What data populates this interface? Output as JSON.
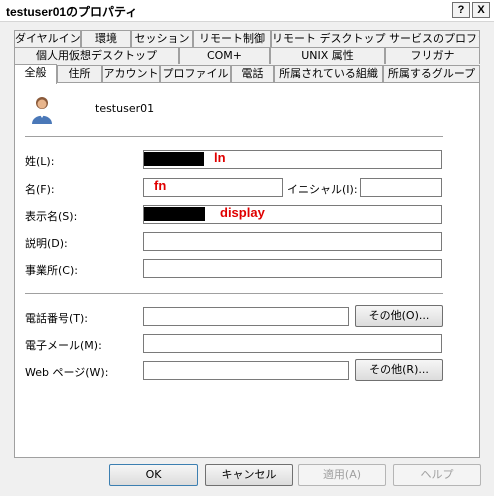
{
  "window": {
    "title": "testuser01のプロパティ",
    "help_label": "?",
    "close_label": "X"
  },
  "tabs_row1": [
    "ダイヤルイン",
    "環境",
    "セッション",
    "リモート制御",
    "リモート デスクトップ サービスのプロファイル"
  ],
  "tabs_row2": [
    "個人用仮想デスクトップ",
    "COM+",
    "UNIX 属性",
    "フリガナ"
  ],
  "tabs_row3": [
    "全般",
    "住所",
    "アカウント",
    "プロファイル",
    "電話",
    "所属されている組織",
    "所属するグループ"
  ],
  "general": {
    "username": "testuser01",
    "last_name_label": "姓(L):",
    "last_name_value": "ln",
    "first_name_label": "名(F):",
    "first_name_value": "fn",
    "initials_label": "イニシャル(I):",
    "initials_value": "",
    "display_name_label": "表示名(S):",
    "display_name_value": "display",
    "description_label": "説明(D):",
    "description_value": "",
    "office_label": "事業所(C):",
    "office_value": "",
    "phone_label": "電話番号(T):",
    "phone_value": "",
    "phone_other_button": "その他(O)...",
    "email_label": "電子メール(M):",
    "email_value": "",
    "web_label": "Web ページ(W):",
    "web_value": "",
    "web_other_button": "その他(R)..."
  },
  "footer": {
    "ok": "OK",
    "cancel": "キャンセル",
    "apply": "適用(A)",
    "help": "ヘルプ"
  }
}
